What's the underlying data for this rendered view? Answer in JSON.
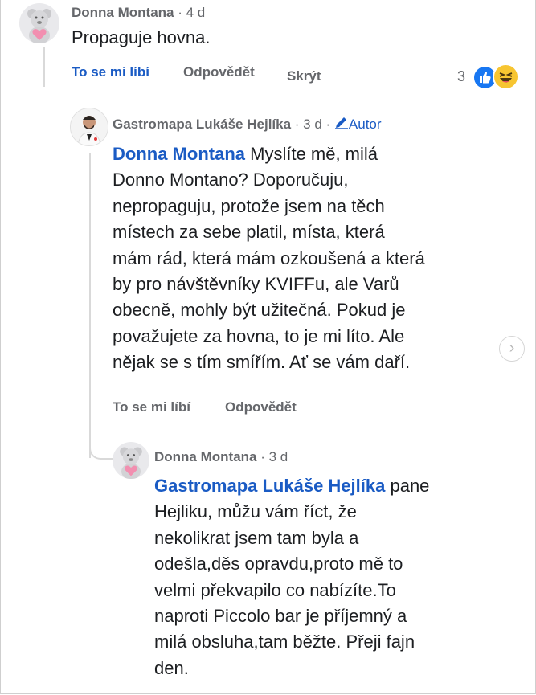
{
  "comment1": {
    "author": "Donna Montana",
    "time": " · 4 d",
    "text": "Propaguje hovna.",
    "like": "To se mi líbí",
    "reply": "Odpovědět",
    "hide": "Skrýt",
    "reaction_count": "3",
    "reaction_icons": [
      "like-icon",
      "haha-icon"
    ]
  },
  "reply1": {
    "author": "Gastromapa Lukáše Hejlíka",
    "time": " · 3 d · ",
    "author_badge": "Autor",
    "mention": "Donna Montana",
    "lines": [
      " Myslíte mě, milá",
      "Donno Montano? Doporučuju,",
      "nepropaguju, protože jsem na těch",
      "místech za sebe platil, místa, která",
      "mám rád, která mám ozkoušená a která",
      "by pro návštěvníky KVIFFu, ale Varů",
      "obecně, mohly být užitečná. Pokud je",
      "považujete za hovna, to je mi líto. Ale",
      "nějak se s tím smířím. Ať se vám daří."
    ],
    "like": "To se mi líbí",
    "reply": "Odpovědět"
  },
  "reply2": {
    "author": "Donna Montana",
    "time": " · 3 d",
    "mention": "Gastromapa Lukáše Hejlíka",
    "lines": [
      " pane",
      "Hejliku, můžu vám říct, že",
      "nekolikrat jsem tam byla a",
      "odešla,děs opravdu,proto mě to",
      "velmi překvapilo co nabízíte.To",
      "naproti Piccolo bar je příjemný a",
      "milá obsluha,tam běžte. Přeji fajn",
      "den."
    ]
  },
  "colors": {
    "link": "#1a5bc4",
    "meta": "#65676b",
    "text": "#1c1e21"
  }
}
